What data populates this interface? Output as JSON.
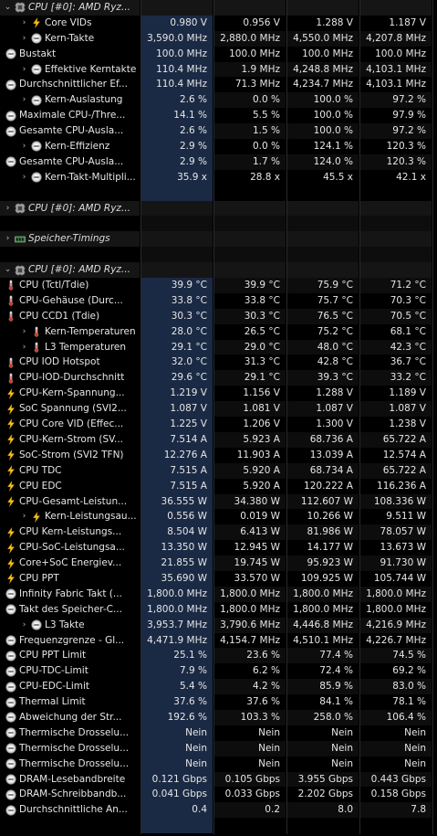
{
  "rows": [
    {
      "type": "header",
      "chev": "v",
      "icon": "cpu-icon",
      "name": "CPU [#0]: AMD Ryz...",
      "indent": 0
    },
    {
      "type": "data",
      "chev": ">",
      "icon": "lightning-icon",
      "name": "Core VIDs",
      "indent": 1,
      "v": [
        "0.980 V",
        "0.956 V",
        "1.288 V",
        "1.187 V"
      ]
    },
    {
      "type": "data",
      "chev": ">",
      "icon": "clock-icon",
      "name": "Kern-Takte",
      "indent": 1,
      "v": [
        "3,590.0 MHz",
        "2,880.0 MHz",
        "4,550.0 MHz",
        "4,207.8 MHz"
      ]
    },
    {
      "type": "data",
      "chev": "",
      "icon": "clock-icon",
      "name": "Bustakt",
      "indent": 0,
      "v": [
        "100.0 MHz",
        "100.0 MHz",
        "100.0 MHz",
        "100.0 MHz"
      ]
    },
    {
      "type": "data",
      "chev": ">",
      "icon": "clock-icon",
      "name": "Effektive Kerntakte",
      "indent": 1,
      "v": [
        "110.4 MHz",
        "1.9 MHz",
        "4,248.8 MHz",
        "4,103.1 MHz"
      ]
    },
    {
      "type": "data",
      "chev": "",
      "icon": "clock-icon",
      "name": "Durchschnittlicher Ef...",
      "indent": 0,
      "v": [
        "110.4 MHz",
        "71.3 MHz",
        "4,234.7 MHz",
        "4,103.1 MHz"
      ]
    },
    {
      "type": "data",
      "chev": ">",
      "icon": "clock-icon",
      "name": "Kern-Auslastung",
      "indent": 1,
      "v": [
        "2.6 %",
        "0.0 %",
        "100.0 %",
        "97.2 %"
      ]
    },
    {
      "type": "data",
      "chev": "",
      "icon": "clock-icon",
      "name": "Maximale CPU-/Thre...",
      "indent": 0,
      "v": [
        "14.1 %",
        "5.5 %",
        "100.0 %",
        "97.9 %"
      ]
    },
    {
      "type": "data",
      "chev": "",
      "icon": "clock-icon",
      "name": "Gesamte CPU-Ausla...",
      "indent": 0,
      "v": [
        "2.6 %",
        "1.5 %",
        "100.0 %",
        "97.2 %"
      ]
    },
    {
      "type": "data",
      "chev": ">",
      "icon": "clock-icon",
      "name": "Kern-Effizienz",
      "indent": 1,
      "v": [
        "2.9 %",
        "0.0 %",
        "124.1 %",
        "120.3 %"
      ]
    },
    {
      "type": "data",
      "chev": "",
      "icon": "clock-icon",
      "name": "Gesamte CPU-Ausla...",
      "indent": 0,
      "v": [
        "2.9 %",
        "1.7 %",
        "124.0 %",
        "120.3 %"
      ]
    },
    {
      "type": "data",
      "chev": ">",
      "icon": "clock-icon",
      "name": "Kern-Takt-Multipli...",
      "indent": 1,
      "v": [
        "35.9 x",
        "28.8 x",
        "45.5 x",
        "42.1 x"
      ]
    },
    {
      "type": "empty"
    },
    {
      "type": "header",
      "chev": ">",
      "icon": "cpu-icon",
      "name": "CPU [#0]: AMD Ryz...",
      "indent": 0
    },
    {
      "type": "empty-dark"
    },
    {
      "type": "header",
      "chev": ">",
      "icon": "ram-icon",
      "name": "Speicher-Timings",
      "indent": 0
    },
    {
      "type": "empty-dark"
    },
    {
      "type": "header",
      "chev": "v",
      "icon": "cpu-icon",
      "name": "CPU [#0]: AMD Ryz...",
      "indent": 0
    },
    {
      "type": "data",
      "chev": "",
      "icon": "thermometer-icon",
      "name": "CPU (Tctl/Tdie)",
      "indent": 0,
      "v": [
        "39.9 °C",
        "39.9 °C",
        "75.9 °C",
        "71.2 °C"
      ]
    },
    {
      "type": "data",
      "chev": "",
      "icon": "thermometer-icon",
      "name": "CPU-Gehäuse (Durc...",
      "indent": 0,
      "v": [
        "33.8 °C",
        "33.8 °C",
        "75.7 °C",
        "70.3 °C"
      ]
    },
    {
      "type": "data",
      "chev": "",
      "icon": "thermometer-icon",
      "name": "CPU CCD1 (Tdie)",
      "indent": 0,
      "v": [
        "30.3 °C",
        "30.3 °C",
        "76.5 °C",
        "70.5 °C"
      ]
    },
    {
      "type": "data",
      "chev": ">",
      "icon": "thermometer-icon",
      "name": "Kern-Temperaturen",
      "indent": 1,
      "v": [
        "28.0 °C",
        "26.5 °C",
        "75.2 °C",
        "68.1 °C"
      ]
    },
    {
      "type": "data",
      "chev": ">",
      "icon": "thermometer-icon",
      "name": "L3 Temperaturen",
      "indent": 1,
      "v": [
        "29.1 °C",
        "29.0 °C",
        "48.0 °C",
        "42.3 °C"
      ]
    },
    {
      "type": "data",
      "chev": "",
      "icon": "thermometer-icon",
      "name": "CPU IOD Hotspot",
      "indent": 0,
      "v": [
        "32.0 °C",
        "31.3 °C",
        "42.8 °C",
        "36.7 °C"
      ]
    },
    {
      "type": "data",
      "chev": "",
      "icon": "thermometer-icon",
      "name": "CPU-IOD-Durchschnitt",
      "indent": 0,
      "v": [
        "29.6 °C",
        "29.1 °C",
        "39.3 °C",
        "33.2 °C"
      ]
    },
    {
      "type": "data",
      "chev": "",
      "icon": "lightning-icon",
      "name": "CPU-Kern-Spannung...",
      "indent": 0,
      "v": [
        "1.219 V",
        "1.156 V",
        "1.288 V",
        "1.189 V"
      ]
    },
    {
      "type": "data",
      "chev": "",
      "icon": "lightning-icon",
      "name": "SoC Spannung (SVI2...",
      "indent": 0,
      "v": [
        "1.087 V",
        "1.081 V",
        "1.087 V",
        "1.087 V"
      ]
    },
    {
      "type": "data",
      "chev": "",
      "icon": "lightning-icon",
      "name": "CPU Core VID (Effec...",
      "indent": 0,
      "v": [
        "1.225 V",
        "1.206 V",
        "1.300 V",
        "1.238 V"
      ]
    },
    {
      "type": "data",
      "chev": "",
      "icon": "lightning-icon",
      "name": "CPU-Kern-Strom (SV...",
      "indent": 0,
      "v": [
        "7.514 A",
        "5.923 A",
        "68.736 A",
        "65.722 A"
      ]
    },
    {
      "type": "data",
      "chev": "",
      "icon": "lightning-icon",
      "name": "SoC-Strom (SVI2 TFN)",
      "indent": 0,
      "v": [
        "12.276 A",
        "11.903 A",
        "13.039 A",
        "12.574 A"
      ]
    },
    {
      "type": "data",
      "chev": "",
      "icon": "lightning-icon",
      "name": "CPU TDC",
      "indent": 0,
      "v": [
        "7.515 A",
        "5.920 A",
        "68.734 A",
        "65.722 A"
      ]
    },
    {
      "type": "data",
      "chev": "",
      "icon": "lightning-icon",
      "name": "CPU EDC",
      "indent": 0,
      "v": [
        "7.515 A",
        "5.920 A",
        "120.222 A",
        "116.236 A"
      ]
    },
    {
      "type": "data",
      "chev": "",
      "icon": "lightning-icon",
      "name": "CPU-Gesamt-Leistun...",
      "indent": 0,
      "v": [
        "36.555 W",
        "34.380 W",
        "112.607 W",
        "108.336 W"
      ]
    },
    {
      "type": "data",
      "chev": ">",
      "icon": "lightning-icon",
      "name": "Kern-Leistungsau...",
      "indent": 1,
      "v": [
        "0.556 W",
        "0.019 W",
        "10.266 W",
        "9.511 W"
      ]
    },
    {
      "type": "data",
      "chev": "",
      "icon": "lightning-icon",
      "name": "CPU Kern-Leistungs...",
      "indent": 0,
      "v": [
        "8.504 W",
        "6.413 W",
        "81.986 W",
        "78.057 W"
      ]
    },
    {
      "type": "data",
      "chev": "",
      "icon": "lightning-icon",
      "name": "CPU-SoC-Leistungsa...",
      "indent": 0,
      "v": [
        "13.350 W",
        "12.945 W",
        "14.177 W",
        "13.673 W"
      ]
    },
    {
      "type": "data",
      "chev": "",
      "icon": "lightning-icon",
      "name": "Core+SoC Energiev...",
      "indent": 0,
      "v": [
        "21.855 W",
        "19.745 W",
        "95.923 W",
        "91.730 W"
      ]
    },
    {
      "type": "data",
      "chev": "",
      "icon": "lightning-icon",
      "name": "CPU PPT",
      "indent": 0,
      "v": [
        "35.690 W",
        "33.570 W",
        "109.925 W",
        "105.744 W"
      ]
    },
    {
      "type": "data",
      "chev": "",
      "icon": "clock-icon",
      "name": "Infinity Fabric Takt (...",
      "indent": 0,
      "v": [
        "1,800.0 MHz",
        "1,800.0 MHz",
        "1,800.0 MHz",
        "1,800.0 MHz"
      ]
    },
    {
      "type": "data",
      "chev": "",
      "icon": "clock-icon",
      "name": "Takt des Speicher-C...",
      "indent": 0,
      "v": [
        "1,800.0 MHz",
        "1,800.0 MHz",
        "1,800.0 MHz",
        "1,800.0 MHz"
      ]
    },
    {
      "type": "data",
      "chev": ">",
      "icon": "clock-icon",
      "name": "L3 Takte",
      "indent": 1,
      "v": [
        "3,953.7 MHz",
        "3,790.6 MHz",
        "4,446.8 MHz",
        "4,216.9 MHz"
      ]
    },
    {
      "type": "data",
      "chev": "",
      "icon": "clock-icon",
      "name": "Frequenzgrenze - Gl...",
      "indent": 0,
      "v": [
        "4,471.9 MHz",
        "4,154.7 MHz",
        "4,510.1 MHz",
        "4,226.7 MHz"
      ]
    },
    {
      "type": "data",
      "chev": "",
      "icon": "clock-icon",
      "name": "CPU PPT Limit",
      "indent": 0,
      "v": [
        "25.1 %",
        "23.6 %",
        "77.4 %",
        "74.5 %"
      ]
    },
    {
      "type": "data",
      "chev": "",
      "icon": "clock-icon",
      "name": "CPU-TDC-Limit",
      "indent": 0,
      "v": [
        "7.9 %",
        "6.2 %",
        "72.4 %",
        "69.2 %"
      ]
    },
    {
      "type": "data",
      "chev": "",
      "icon": "clock-icon",
      "name": "CPU-EDC-Limit",
      "indent": 0,
      "v": [
        "5.4 %",
        "4.2 %",
        "85.9 %",
        "83.0 %"
      ]
    },
    {
      "type": "data",
      "chev": "",
      "icon": "clock-icon",
      "name": "Thermal Limit",
      "indent": 0,
      "v": [
        "37.6 %",
        "37.6 %",
        "84.1 %",
        "78.1 %"
      ]
    },
    {
      "type": "data",
      "chev": "",
      "icon": "clock-icon",
      "name": "Abweichung der Str...",
      "indent": 0,
      "v": [
        "192.6 %",
        "103.3 %",
        "258.0 %",
        "106.4 %"
      ]
    },
    {
      "type": "data",
      "chev": "",
      "icon": "clock-icon",
      "name": "Thermische Drosselu...",
      "indent": 0,
      "v": [
        "Nein",
        "Nein",
        "Nein",
        "Nein"
      ]
    },
    {
      "type": "data",
      "chev": "",
      "icon": "clock-icon",
      "name": "Thermische Drosselu...",
      "indent": 0,
      "v": [
        "Nein",
        "Nein",
        "Nein",
        "Nein"
      ]
    },
    {
      "type": "data",
      "chev": "",
      "icon": "clock-icon",
      "name": "Thermische Drosselu...",
      "indent": 0,
      "v": [
        "Nein",
        "Nein",
        "Nein",
        "Nein"
      ]
    },
    {
      "type": "data",
      "chev": "",
      "icon": "clock-icon",
      "name": "DRAM-Lesebandbreite",
      "indent": 0,
      "v": [
        "0.121 Gbps",
        "0.105 Gbps",
        "3.955 Gbps",
        "0.443 Gbps"
      ]
    },
    {
      "type": "data",
      "chev": "",
      "icon": "clock-icon",
      "name": "DRAM-Schreibbandb...",
      "indent": 0,
      "v": [
        "0.041 Gbps",
        "0.033 Gbps",
        "2.202 Gbps",
        "0.158 Gbps"
      ]
    },
    {
      "type": "data",
      "chev": "",
      "icon": "clock-icon",
      "name": "Durchschnittliche An...",
      "indent": 0,
      "v": [
        "0.4",
        "0.2",
        "8.0",
        "7.8"
      ]
    },
    {
      "type": "empty"
    }
  ],
  "colors": {
    "value_col_bg": "#1b2a44",
    "background": "#000000",
    "text": "#e6e6e6"
  }
}
